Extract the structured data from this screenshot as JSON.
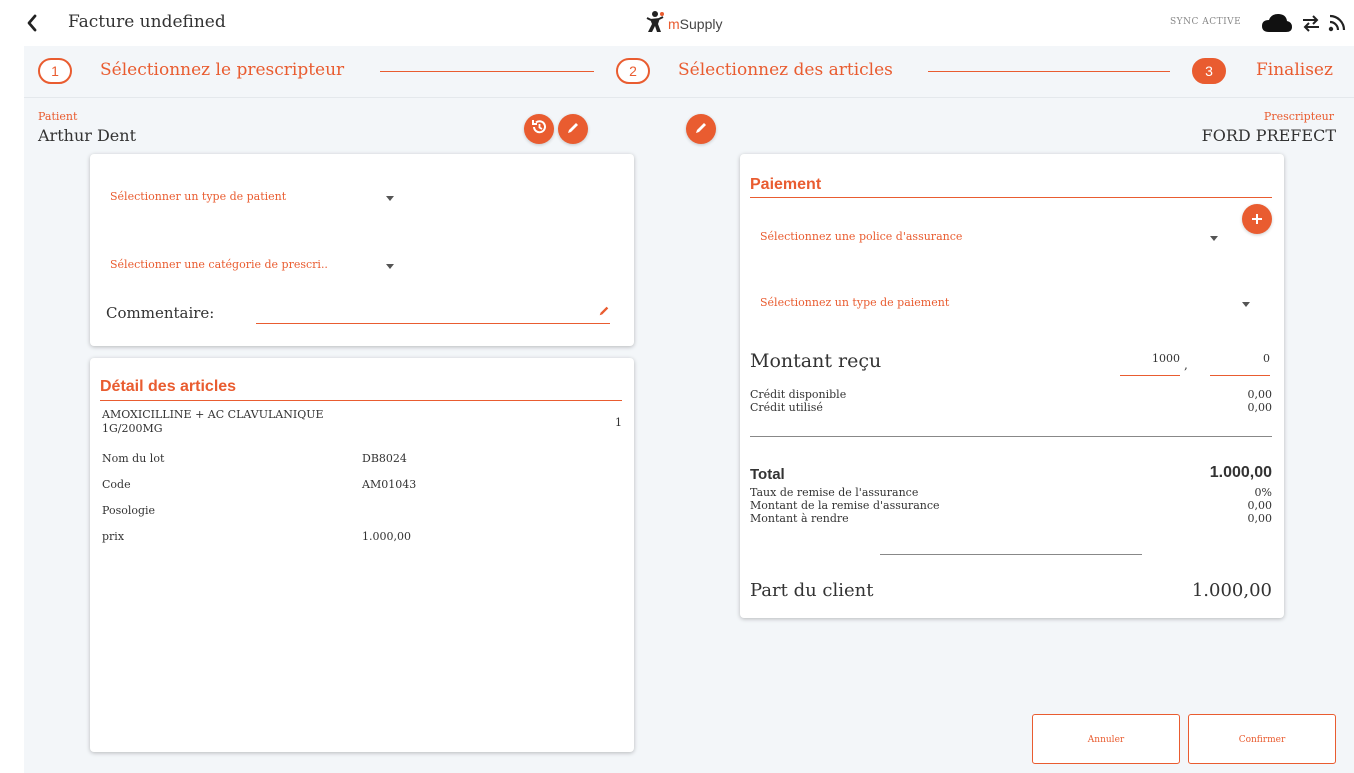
{
  "header": {
    "title": "Facture undefined",
    "brand": "mSupply",
    "brand_m": "m",
    "brand_rest": "Supply",
    "sync_status": "SYNC ACTIVE"
  },
  "stepper": {
    "steps": [
      {
        "number": "1",
        "label": "Sélectionnez le prescripteur"
      },
      {
        "number": "2",
        "label": "Sélectionnez des articles"
      },
      {
        "number": "3",
        "label": "Finalisez"
      }
    ]
  },
  "patient": {
    "label": "Patient",
    "name": "Arthur Dent"
  },
  "prescriber": {
    "label": "Prescripteur",
    "name": "FORD PREFECT"
  },
  "patient_form": {
    "patient_type_placeholder": "Sélectionner un type de patient",
    "prescription_category_placeholder": "Sélectionner une catégorie de prescri..",
    "comment_label": "Commentaire:",
    "comment_value": ""
  },
  "items": {
    "title": "Détail des articles",
    "list": [
      {
        "name_line1": "AMOXICILLINE + AC CLAVULANIQUE",
        "name_line2": "1G/200MG",
        "quantity": "1",
        "fields": [
          {
            "label": "Nom du lot",
            "value": "DB8024"
          },
          {
            "label": "Code",
            "value": "AM01043"
          },
          {
            "label": "Posologie",
            "value": ""
          },
          {
            "label": "prix",
            "value": "1.000,00"
          }
        ]
      }
    ]
  },
  "payment": {
    "title": "Paiement",
    "insurance_placeholder": "Sélectionnez une police d'assurance",
    "payment_type_placeholder": "Sélectionnez un type de paiement",
    "amount_received_label": "Montant reçu",
    "amount_whole": "1000",
    "amount_separator": ",",
    "amount_decimal": "0",
    "credit_available_label": "Crédit disponible",
    "credit_available_value": "0,00",
    "credit_used_label": "Crédit utilisé",
    "credit_used_value": "0,00",
    "total_label": "Total",
    "total_value": "1.000,00",
    "insurance_discount_rate_label": "Taux de remise de l'assurance",
    "insurance_discount_rate_value": "0%",
    "insurance_discount_amount_label": "Montant de la remise d'assurance",
    "insurance_discount_amount_value": "0,00",
    "change_label": "Montant à rendre",
    "change_value": "0,00",
    "client_share_label": "Part du client",
    "client_share_value": "1.000,00"
  },
  "actions": {
    "cancel_label": "Annuler",
    "confirm_label": "Confirmer"
  },
  "colors": {
    "accent": "#e95c30",
    "background": "#f3f6f9"
  }
}
